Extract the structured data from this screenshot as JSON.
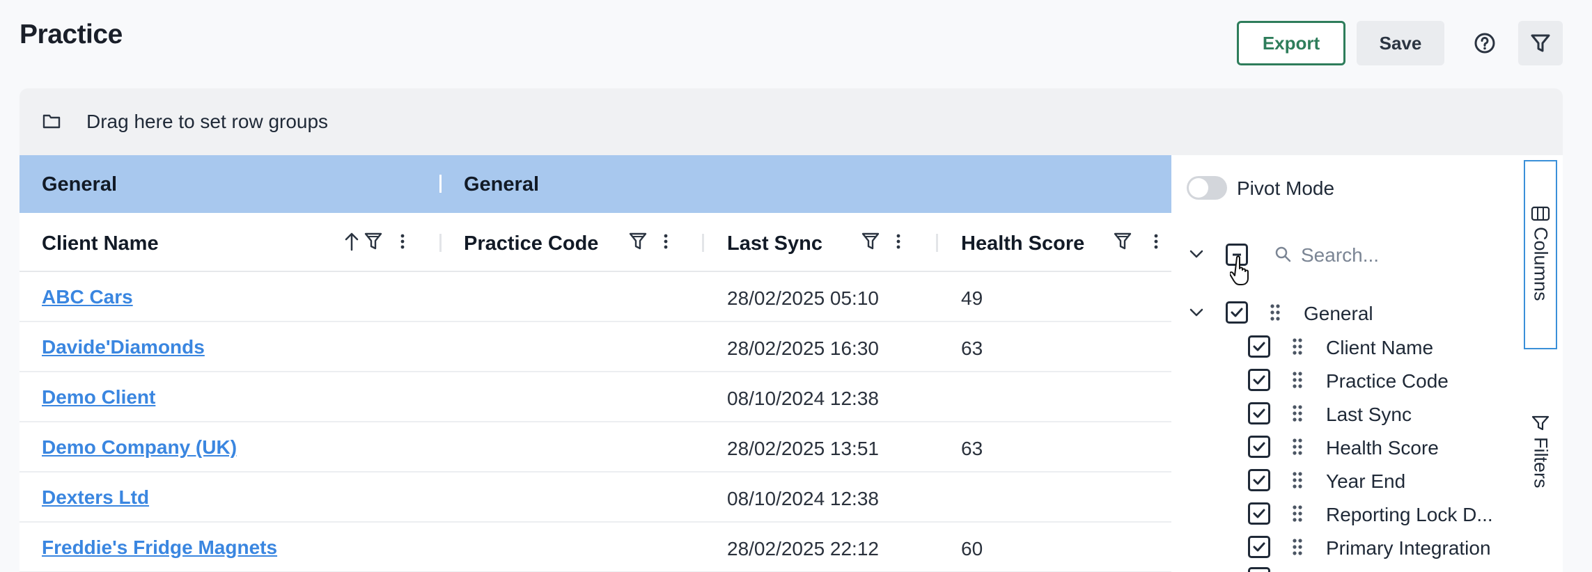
{
  "header": {
    "title": "Practice",
    "export_label": "Export",
    "save_label": "Save"
  },
  "row_group_bar": {
    "label": "Drag here to set row groups"
  },
  "grid": {
    "group_headers": [
      "General",
      "General"
    ],
    "columns": [
      "Client Name",
      "Practice Code",
      "Last Sync",
      "Health Score"
    ],
    "rows": [
      {
        "client": "ABC Cars",
        "practice_code": "",
        "last_sync": "28/02/2025 05:10",
        "health": "49"
      },
      {
        "client": "Davide'Diamonds",
        "practice_code": "",
        "last_sync": "28/02/2025 16:30",
        "health": "63"
      },
      {
        "client": "Demo Client",
        "practice_code": "",
        "last_sync": "08/10/2024 12:38",
        "health": ""
      },
      {
        "client": "Demo Company (UK)",
        "practice_code": "",
        "last_sync": "28/02/2025 13:51",
        "health": "63"
      },
      {
        "client": "Dexters Ltd",
        "practice_code": "",
        "last_sync": "08/10/2024 12:38",
        "health": ""
      },
      {
        "client": "Freddie's Fridge Magnets",
        "practice_code": "",
        "last_sync": "28/02/2025 22:12",
        "health": "60"
      }
    ]
  },
  "side_panel": {
    "pivot_label": "Pivot Mode",
    "search_placeholder": "Search...",
    "group_label": "General",
    "columns": [
      "Client Name",
      "Practice Code",
      "Last Sync",
      "Health Score",
      "Year End",
      "Reporting Lock D...",
      "Primary Integration"
    ],
    "tabs": {
      "columns": "Columns",
      "filters": "Filters"
    }
  },
  "colors": {
    "accent_green": "#2e7d5b",
    "group_header_blue": "#a8c8ee",
    "link_blue": "#3a86e0",
    "tab_border_blue": "#3a8fd8"
  }
}
